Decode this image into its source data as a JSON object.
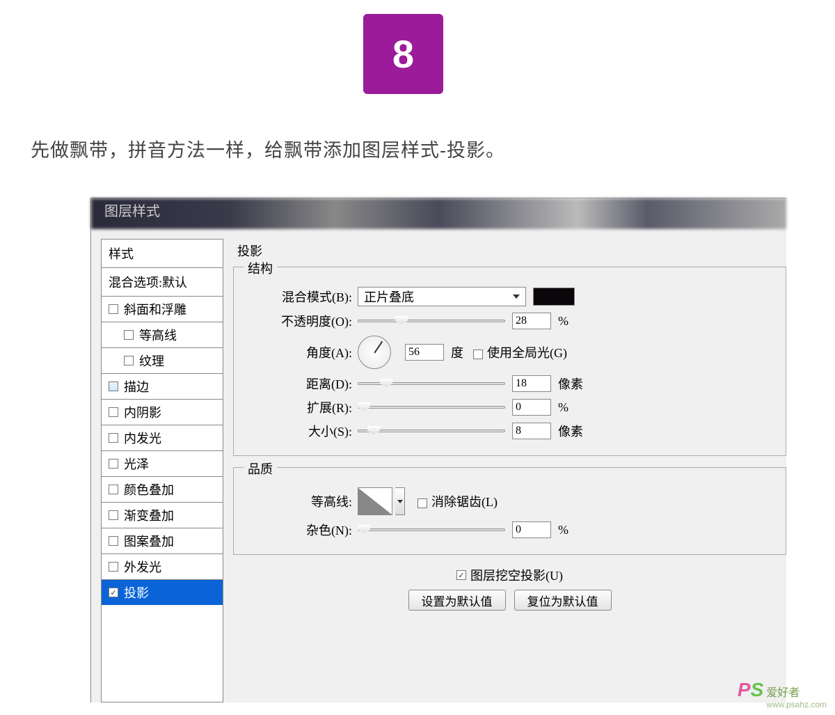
{
  "step_number": "8",
  "instruction": "先做飘带，拼音方法一样，给飘带添加图层样式-投影。",
  "dialog_title": "图层样式",
  "sidebar": {
    "header": "样式",
    "blending_options": "混合选项:默认",
    "items": [
      {
        "label": "斜面和浮雕",
        "checked": false
      },
      {
        "label": "等高线",
        "checked": false,
        "sub": true
      },
      {
        "label": "纹理",
        "checked": false,
        "sub": true
      },
      {
        "label": "描边",
        "checked": false,
        "blue": true
      },
      {
        "label": "内阴影",
        "checked": false
      },
      {
        "label": "内发光",
        "checked": false
      },
      {
        "label": "光泽",
        "checked": false
      },
      {
        "label": "颜色叠加",
        "checked": false
      },
      {
        "label": "渐变叠加",
        "checked": false
      },
      {
        "label": "图案叠加",
        "checked": false
      },
      {
        "label": "外发光",
        "checked": false
      },
      {
        "label": "投影",
        "checked": true,
        "selected": true
      }
    ]
  },
  "panel": {
    "group_title": "投影",
    "section_structure": "结构",
    "section_quality": "品质",
    "blend_mode_label": "混合模式(B):",
    "blend_mode_value": "正片叠底",
    "opacity_label": "不透明度(O):",
    "opacity_value": "28",
    "opacity_unit": "%",
    "angle_label": "角度(A):",
    "angle_value": "56",
    "angle_unit": "度",
    "global_light_label": "使用全局光(G)",
    "distance_label": "距离(D):",
    "distance_value": "18",
    "distance_unit": "像素",
    "spread_label": "扩展(R):",
    "spread_value": "0",
    "spread_unit": "%",
    "size_label": "大小(S):",
    "size_value": "8",
    "size_unit": "像素",
    "contour_label": "等高线:",
    "antialias_label": "消除锯齿(L)",
    "noise_label": "杂色(N):",
    "noise_value": "0",
    "noise_unit": "%",
    "knockout_label": "图层挖空投影(U)",
    "set_default_btn": "设置为默认值",
    "reset_default_btn": "复位为默认值"
  },
  "watermark": {
    "cn": "爱好者",
    "url": "www.psahz.com"
  }
}
